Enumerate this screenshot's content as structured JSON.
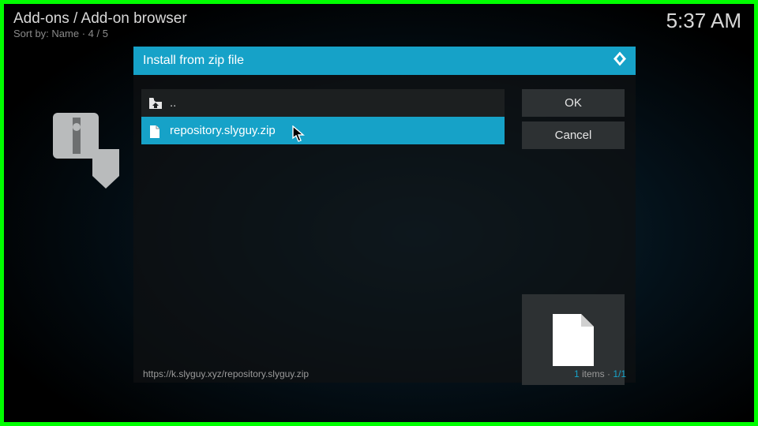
{
  "header": {
    "title": "Add-ons / Add-on browser",
    "sort": "Sort by: Name   ·  4 / 5",
    "time": "5:37 AM"
  },
  "dialog": {
    "title": "Install from zip file",
    "parent_label": "..",
    "files": [
      {
        "name": "repository.slyguy.zip",
        "selected": true
      }
    ],
    "ok_label": "OK",
    "cancel_label": "Cancel",
    "footer_path": "https://k.slyguy.xyz/repository.slyguy.zip",
    "footer_count_num": "1",
    "footer_count_label": " items · ",
    "footer_count_pos": "1/1"
  }
}
